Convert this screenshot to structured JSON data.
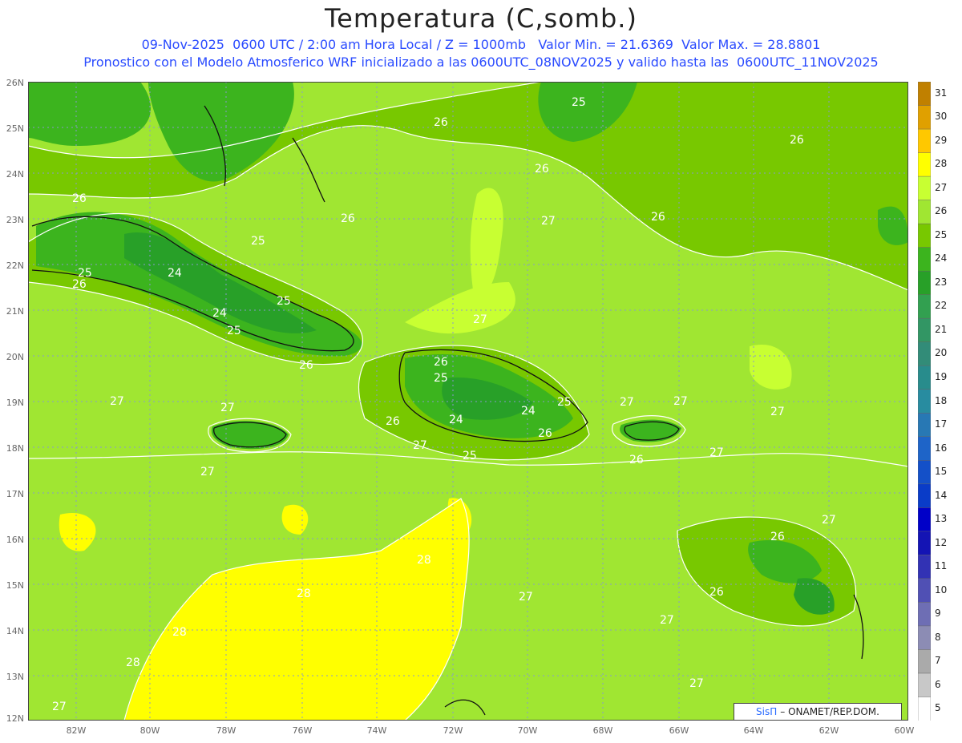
{
  "header": {
    "title": "Temperatura (C,somb.)",
    "line1": "09-Nov-2025  0600 UTC / 2:00 am Hora Local / Z = 1000mb   Valor Min. = 21.6369  Valor Max. = 28.8801",
    "line2": "Pronostico con el Modelo Atmosferico WRF inicializado a las 0600UTC_08NOV2025 y valido hasta las  0600UTC_11NOV2025"
  },
  "axes": {
    "lat_labels": [
      "26N",
      "25N",
      "24N",
      "23N",
      "22N",
      "21N",
      "20N",
      "19N",
      "18N",
      "17N",
      "16N",
      "15N",
      "14N",
      "13N",
      "12N"
    ],
    "lon_labels": [
      "82W",
      "80W",
      "78W",
      "76W",
      "74W",
      "72W",
      "70W",
      "68W",
      "66W",
      "64W",
      "62W",
      "60W"
    ]
  },
  "colorbar": {
    "labels": [
      "31",
      "30",
      "29",
      "28",
      "27",
      "26",
      "25",
      "24",
      "23",
      "22",
      "21",
      "20",
      "19",
      "18",
      "17",
      "16",
      "15",
      "14",
      "13",
      "12",
      "11",
      "10",
      "9",
      "8",
      "7",
      "6",
      "5"
    ],
    "colors": [
      "#c08000",
      "#e0a000",
      "#ffc800",
      "#ffff00",
      "#c8ff32",
      "#a0e632",
      "#78c800",
      "#3cb41e",
      "#28a028",
      "#32a050",
      "#329664",
      "#328c78",
      "#288c8c",
      "#288ca0",
      "#2878b4",
      "#1e64c8",
      "#1450c8",
      "#0a3cc8",
      "#0000c8",
      "#1414b4",
      "#3232b4",
      "#5050b4",
      "#6e6eb4",
      "#8c8cb4",
      "#aaaaaa",
      "#c8c8c8",
      "#ffffff"
    ]
  },
  "contour_labels": [
    "26",
    "25",
    "24",
    "27",
    "28"
  ],
  "credit": {
    "brand": "SisΠ",
    "text": "– ONAMET/REP.DOM."
  }
}
